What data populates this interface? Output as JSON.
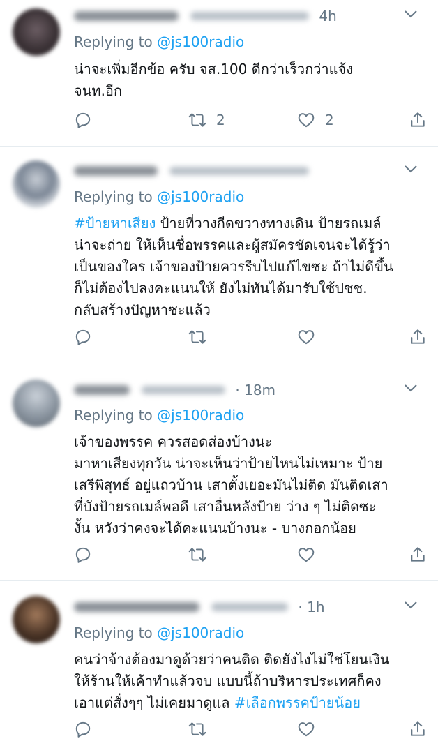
{
  "tweets": [
    {
      "avatar_color": "#3b3236",
      "time": "4h",
      "replying_prefix": "Replying to",
      "replying_handle": "@js100radio",
      "lines": [
        [
          {
            "t": "น่าจะเพิ่มอีกข้อ ครับ จส.100 ดีกว่าเร็วกว่าแจ้ง"
          }
        ],
        [
          {
            "t": "จนท.อีก"
          }
        ]
      ],
      "counts": {
        "reply": "",
        "retweet": "2",
        "like": "2"
      }
    },
    {
      "avatar_color": "#7c8796",
      "time": "",
      "replying_prefix": "Replying to",
      "replying_handle": "@js100radio",
      "lines": [
        [
          {
            "t": "#ป้ายหาเสียง",
            "h": true
          },
          {
            "t": " ป้ายที่วางกีดขวางทางเดิน ป้ายรถเมล์"
          }
        ],
        [
          {
            "t": "น่าจะถ่าย ให้เห็นชื่อพรรคและผู้สมัครชัดเจนจะได้รู้ว่า"
          }
        ],
        [
          {
            "t": "เป็นของใคร เจ้าของป้ายควรรีบไปแก้ไขซะ ถ้าไม่ดีขึ้น"
          }
        ],
        [
          {
            "t": "ก็ไม่ต้องไปลงคะแนนให้ ยังไม่ทันได้มารับใช้ปชช."
          }
        ],
        [
          {
            "t": "กลับสร้างปัญหาซะแล้ว"
          }
        ]
      ],
      "counts": {
        "reply": "",
        "retweet": "",
        "like": ""
      }
    },
    {
      "avatar_color": "#8e98a3",
      "time": "· 18m",
      "replying_prefix": "Replying to",
      "replying_handle": "@js100radio",
      "lines": [
        [
          {
            "t": "เจ้าของพรรค ควรสอดส่องบ้างนะ"
          }
        ],
        [
          {
            "t": "มาหาเสียงทุกวัน น่าจะเห็นว่าป้ายไหนไม่เหมาะ  ป้าย"
          }
        ],
        [
          {
            "t": "เสรีพิสุทธ์ อยู่แถวบ้าน  เสาตั้งเยอะมันไม่ติด มันติดเสา"
          }
        ],
        [
          {
            "t": "ที่บังป้ายรถเมล์พอดี  เสาอื่นหลังป้าย ว่าง ๆ ไม่ติดซะ"
          }
        ],
        [
          {
            "t": "งั้น  หวังว่าคงจะได้คะแนนบ้างนะ - บางกอกน้อย"
          }
        ]
      ],
      "counts": {
        "reply": "",
        "retweet": "",
        "like": ""
      }
    },
    {
      "avatar_color": "#4a3426",
      "time": "· 1h",
      "replying_prefix": "Replying to",
      "replying_handle": "@js100radio",
      "lines": [
        [
          {
            "t": "คนว่าจ้างต้องมาดูด้วยว่าคนติด ติดยังไงไม่ใช่โยนเงิน"
          }
        ],
        [
          {
            "t": "ให้ร้านให้เค้าทำแล้วจบ แบบนี้ถ้าบริหารประเทศก็คง"
          }
        ],
        [
          {
            "t": "เอาแต่สั่งๆๆ ไม่เคยมาดูแล "
          },
          {
            "t": "#เลือกพรรคป้ายน้อย",
            "h": true
          }
        ]
      ],
      "counts": {
        "reply": "",
        "retweet": "",
        "like": ""
      }
    }
  ],
  "icons": [
    "reply-icon",
    "retweet-icon",
    "like-icon",
    "share-icon",
    "caret-down-icon"
  ]
}
